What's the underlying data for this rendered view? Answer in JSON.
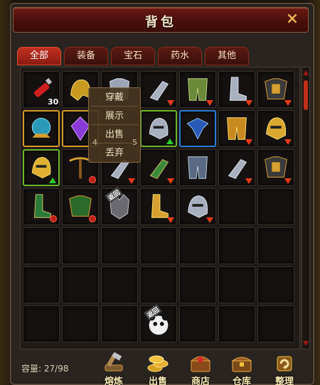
{
  "window": {
    "title": "背包",
    "close_label": "×"
  },
  "tabs": [
    {
      "label": "全部",
      "active": true
    },
    {
      "label": "装备",
      "active": false
    },
    {
      "label": "宝石",
      "active": false
    },
    {
      "label": "药水",
      "active": false
    },
    {
      "label": "其他",
      "active": false
    }
  ],
  "context_menu": {
    "items": [
      "穿戴",
      "展示",
      "出售",
      "丢弃"
    ],
    "side_numbers": [
      "4",
      "5"
    ]
  },
  "inventory": {
    "items": [
      {
        "icon": "red-potion-icon",
        "count": "30",
        "frame": ""
      },
      {
        "icon": "gold-helmet-icon",
        "frame": ""
      },
      {
        "icon": "silver-armor-icon",
        "frame": ""
      },
      {
        "icon": "silver-gauntlet-icon",
        "badge": "down",
        "frame": ""
      },
      {
        "icon": "green-pants-icon",
        "badge": "down",
        "frame": ""
      },
      {
        "icon": "silver-boots-icon",
        "badge": "down",
        "frame": ""
      },
      {
        "icon": "gold-armor-icon",
        "badge": "down",
        "frame": ""
      },
      {
        "icon": "blue-orb-icon",
        "frame": "gold"
      },
      {
        "icon": "purple-gem-icon",
        "frame": "gold"
      },
      {
        "icon": "hidden-item",
        "frame": ""
      },
      {
        "icon": "silver-helmet-icon",
        "badge": "up",
        "frame": "green"
      },
      {
        "icon": "blue-crest-icon",
        "frame": "blue"
      },
      {
        "icon": "gold-pants-icon",
        "badge": "down",
        "frame": ""
      },
      {
        "icon": "gold-helmet-2-icon",
        "badge": "down",
        "frame": ""
      },
      {
        "icon": "gold-helmet-3-icon",
        "badge": "up",
        "frame": "green"
      },
      {
        "icon": "crossbow-icon",
        "badge": "blocked",
        "frame": ""
      },
      {
        "icon": "silver-gauntlet-icon",
        "badge": "down",
        "frame": ""
      },
      {
        "icon": "green-gauntlet-icon",
        "badge": "down",
        "frame": ""
      },
      {
        "icon": "silver-pants-icon",
        "frame": ""
      },
      {
        "icon": "silver-gauntlet-icon",
        "badge": "down",
        "frame": ""
      },
      {
        "icon": "gold-armor-icon",
        "badge": "down",
        "frame": ""
      },
      {
        "icon": "green-boots-icon",
        "badge": "blocked",
        "frame": ""
      },
      {
        "icon": "green-armor-icon",
        "badge": "blocked",
        "frame": ""
      },
      {
        "icon": "wolf-head-icon",
        "seal": "返回",
        "frame": ""
      },
      {
        "icon": "gold-boots-icon",
        "badge": "down",
        "frame": ""
      },
      {
        "icon": "silver-helmet-icon",
        "badge": "down",
        "frame": ""
      }
    ],
    "panda_item": {
      "icon": "panda-head-icon",
      "seal": "返回"
    },
    "capacity_label": "容量:",
    "capacity_value": "27/98"
  },
  "actions": [
    {
      "icon": "forge-hammer-icon",
      "label": "熔炼"
    },
    {
      "icon": "gold-coins-icon",
      "label": "出售"
    },
    {
      "icon": "shop-chest-icon",
      "label": "商店"
    },
    {
      "icon": "warehouse-chest-icon",
      "label": "仓库"
    },
    {
      "icon": "sort-cycle-icon",
      "label": "整理"
    }
  ],
  "colors": {
    "accent_red": "#c03020",
    "title_text": "#f2e6c8",
    "upgrade_green": "#2ad02a",
    "downgrade_red": "#e83a1a"
  }
}
